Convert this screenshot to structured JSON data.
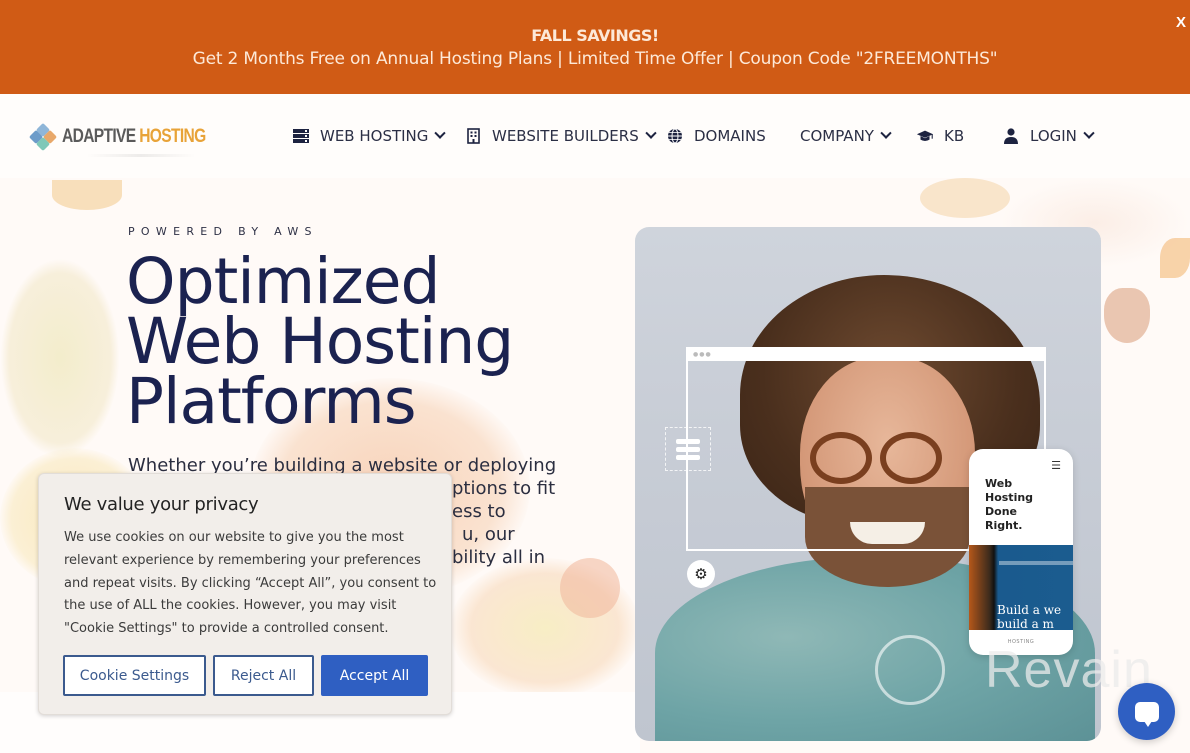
{
  "promo": {
    "title": "FALL SAVINGS!",
    "message": "Get 2 Months Free on Annual Hosting Plans | Limited Time Offer | Coupon Code \"2FREEMONTHS\"",
    "close_label": "X",
    "background_color": "#d05b15"
  },
  "header": {
    "logo": {
      "part1": "ADAPTIVE",
      "part2": "HOSTING"
    },
    "nav": [
      {
        "label": "WEB HOSTING",
        "icon": "server-icon",
        "has_dropdown": true
      },
      {
        "label": "WEBSITE BUILDERS",
        "icon": "building-icon",
        "has_dropdown": true
      },
      {
        "label": "DOMAINS",
        "icon": "globe-icon",
        "has_dropdown": false
      },
      {
        "label": "COMPANY",
        "icon": null,
        "has_dropdown": true
      },
      {
        "label": "KB",
        "icon": "graduation-cap-icon",
        "has_dropdown": false
      },
      {
        "label": "LOGIN",
        "icon": "user-icon",
        "has_dropdown": true
      }
    ]
  },
  "hero": {
    "eyebrow": "POWERED BY AWS",
    "headline_lines": [
      "Optimized",
      "Web Hosting",
      "Platforms"
    ],
    "subtext_lines": [
      "Whether you’re building a website or deploying",
      "ptions to fit",
      "ess to",
      "u, our",
      "bility all in"
    ],
    "phone_card": {
      "title": "Web Hosting Done Right.",
      "screenshot_text": "Build a we\nbuild a m",
      "footer": "HOSTING"
    },
    "headline_color": "#1b2250"
  },
  "cookie_banner": {
    "title": "We value your privacy",
    "body": "We use cookies on our website to give you the most relevant experience by remembering your preferences and repeat visits. By clicking “Accept All”, you consent to the use of ALL the cookies. However, you may visit \"Cookie Settings\" to provide a controlled consent.",
    "buttons": {
      "settings": "Cookie Settings",
      "reject": "Reject All",
      "accept": "Accept All"
    },
    "accent_color": "#2f5fc2"
  },
  "watermark": {
    "text": "Revain"
  },
  "chat": {
    "icon": "chat-bubble-icon"
  }
}
